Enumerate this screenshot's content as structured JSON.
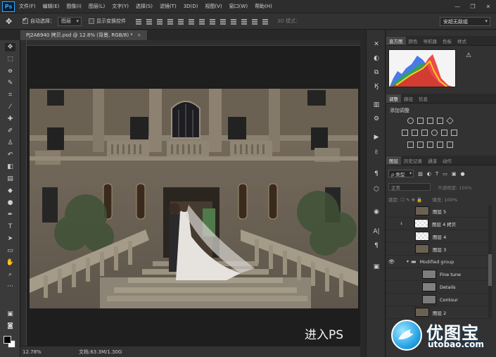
{
  "app": {
    "logo": "Ps"
  },
  "menu": [
    "文件(F)",
    "编辑(E)",
    "图像(I)",
    "图层(L)",
    "文字(Y)",
    "选择(S)",
    "滤镜(T)",
    "3D(D)",
    "视图(V)",
    "窗口(W)",
    "帮助(H)"
  ],
  "window_controls": [
    "—",
    "❐",
    "✕"
  ],
  "options": {
    "auto_select_label": "自动选择：",
    "auto_select_target": "图层",
    "show_transform_label": "显示变换控件",
    "mode_3d_label": "3D 模式：",
    "workspace": "安超无敌组"
  },
  "document_tab": {
    "title": "PJ2A6940 拷贝.psd @ 12.8% (背景, RGB/8) *",
    "close": "×"
  },
  "canvas": {
    "overlay_text": "进入PS"
  },
  "status": {
    "zoom": "12.78%",
    "doc_info": "文档:63.3M/1.30G"
  },
  "panel_tabs_top": [
    {
      "label": "直方图",
      "active": true
    },
    {
      "label": "颜色",
      "active": false
    },
    {
      "label": "导航器",
      "active": false
    },
    {
      "label": "色板",
      "active": false
    },
    {
      "label": "样式",
      "active": false
    }
  ],
  "panel_tabs_mid": [
    {
      "label": "调整",
      "active": true
    },
    {
      "label": "路径",
      "active": false
    },
    {
      "label": "信息",
      "active": false
    }
  ],
  "adjustments": {
    "add_label": "添加调整"
  },
  "panel_tabs_layers": [
    {
      "label": "图层",
      "active": true
    },
    {
      "label": "历史记录",
      "active": false
    },
    {
      "label": "通道",
      "active": false
    },
    {
      "label": "动作",
      "active": false
    }
  ],
  "layers_panel": {
    "kind_filter": "ρ 类型",
    "blend_mode": "正常",
    "opacity_label": "不透明度: 100%",
    "lock_label": "锁定: ☐ ✎ ✥ 🔒",
    "fill_label": "填充: 100%"
  },
  "layers": [
    {
      "name": "图层 5",
      "visible": false,
      "thumb": "photo",
      "folder": false
    },
    {
      "name": "图层 4 拷贝",
      "visible": false,
      "thumb": "checker",
      "folder": false
    },
    {
      "name": "图层 4",
      "visible": false,
      "thumb": "checker",
      "folder": false
    },
    {
      "name": "图层 3",
      "visible": false,
      "thumb": "photo",
      "folder": false
    },
    {
      "name": "Modified group",
      "visible": true,
      "thumb": "folder",
      "folder": true
    },
    {
      "name": "Fine tune",
      "visible": false,
      "thumb": "gray",
      "folder": false
    },
    {
      "name": "Details",
      "visible": false,
      "thumb": "gray",
      "folder": false
    },
    {
      "name": "Contour",
      "visible": false,
      "thumb": "gray",
      "folder": false
    },
    {
      "name": "图层 2",
      "visible": false,
      "thumb": "photo",
      "folder": false
    }
  ],
  "logo": {
    "chinese": "优图宝",
    "url": "utobao.com"
  }
}
